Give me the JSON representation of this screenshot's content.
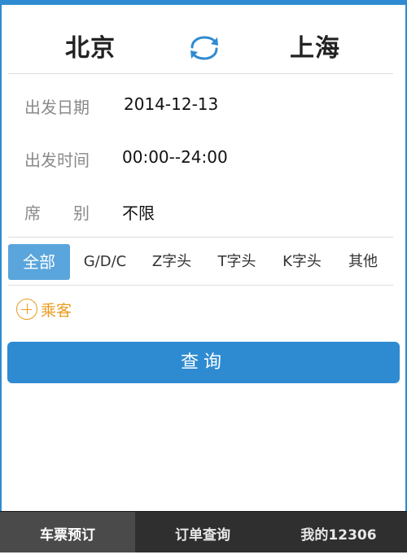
{
  "route": {
    "from": "北京",
    "to": "上海"
  },
  "form": {
    "date_label": "出发日期",
    "date_value": "2014-12-13",
    "time_label": "出发时间",
    "time_value": "00:00--24:00",
    "seat_label_1": "席",
    "seat_label_2": "别",
    "seat_value": "不限"
  },
  "train_types": [
    {
      "label": "全部",
      "active": true
    },
    {
      "label": "G/D/C",
      "active": false
    },
    {
      "label": "Z字头",
      "active": false
    },
    {
      "label": "T字头",
      "active": false
    },
    {
      "label": "K字头",
      "active": false
    },
    {
      "label": "其他",
      "active": false
    }
  ],
  "passenger": {
    "add_label": "乘客"
  },
  "query_button": "查询",
  "bottom_nav": [
    {
      "label": "车票预订",
      "active": true
    },
    {
      "label": "订单查询",
      "active": false
    },
    {
      "label": "我的12306",
      "active": false
    }
  ],
  "colors": {
    "accent": "#2e8bd1",
    "tab_active": "#5aa5dc",
    "passenger": "#e89c1f",
    "nav_bg": "#2f2f2f"
  },
  "icons": {
    "swap": "swap-arrows-icon",
    "add": "plus-circle-icon"
  }
}
